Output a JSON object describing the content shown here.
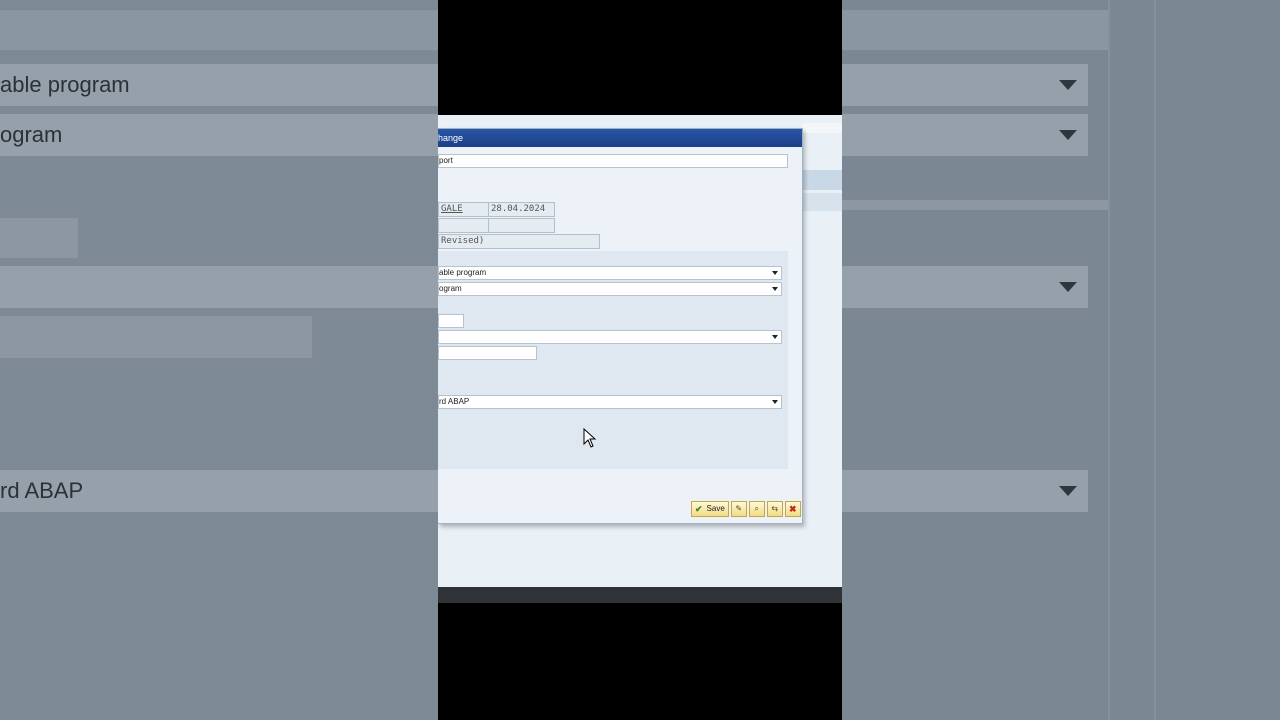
{
  "background": {
    "left_fields": [
      "able program",
      "ogram",
      "",
      "",
      "",
      "rd ABAP"
    ],
    "right_fields": [
      "",
      "",
      "",
      "",
      ""
    ]
  },
  "dialog": {
    "title": "hange",
    "title_field": "port",
    "created_by": "GALE",
    "created_on": "28.04.2024",
    "status": "Revised)",
    "type_value": "able program",
    "status_value": "ogram",
    "language_value": "rd ABAP",
    "save_label": "Save"
  },
  "colors": {
    "titlebar": "#2a56a6",
    "button": "#f2dc86",
    "close": "#c62b1a"
  }
}
